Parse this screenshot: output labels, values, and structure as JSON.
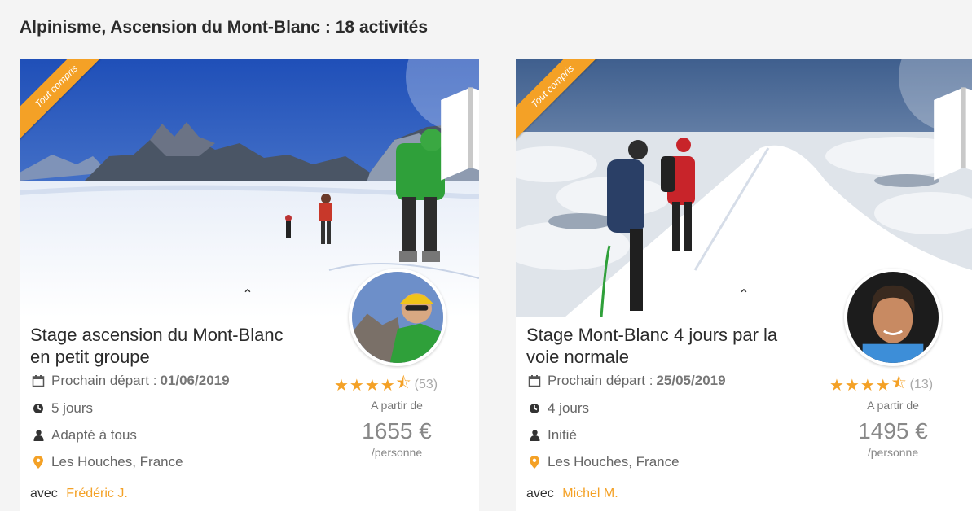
{
  "page": {
    "title": "Alpinisme, Ascension du Mont-Blanc : 18 activités"
  },
  "colors": {
    "accent": "#f4a126",
    "title": "#2b2b2b",
    "muted": "#777777"
  },
  "cards": [
    {
      "badge": "Tout compris",
      "map_icon": "map-icon",
      "title": "Stage ascension du Mont-Blanc en petit groupe",
      "next_departure_label": "Prochain départ :",
      "next_departure_date": "01/06/2019",
      "duration": "5 jours",
      "level": "Adapté à tous",
      "location": "Les Houches, France",
      "rating": 4.5,
      "stars": "★★★★",
      "half_star": "⯪",
      "reviews": "(53)",
      "price_from": "A partir de",
      "price": "1655 €",
      "per": "/personne",
      "guide_prefix": "avec",
      "guide_name": "Frédéric J."
    },
    {
      "badge": "Tout compris",
      "map_icon": "map-icon",
      "title": "Stage Mont-Blanc 4 jours par la voie normale",
      "next_departure_label": "Prochain départ :",
      "next_departure_date": "25/05/2019",
      "duration": "4 jours",
      "level": "Initié",
      "location": "Les Houches, France",
      "rating": 4.5,
      "stars": "★★★★",
      "half_star": "⯪",
      "reviews": "(13)",
      "price_from": "A partir de",
      "price": "1495 €",
      "per": "/personne",
      "guide_prefix": "avec",
      "guide_name": "Michel M."
    }
  ]
}
